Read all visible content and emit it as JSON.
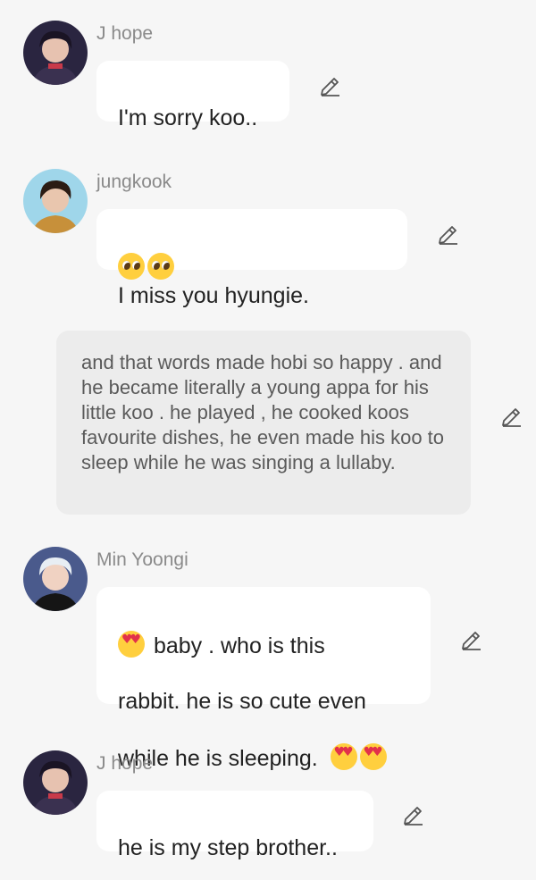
{
  "colors": {
    "background": "#f6f6f6",
    "bubble": "#ffffff",
    "narration_bg": "#ececec",
    "name_text": "#8a8a8a"
  },
  "messages": [
    {
      "author": "J hope",
      "text": "I'm sorry koo..",
      "avatar_icon": "jhope-avatar"
    },
    {
      "author": "jungkook",
      "emoji": "pleading-face-icon x2",
      "text": "I miss you hyungie.",
      "avatar_icon": "jungkook-avatar"
    },
    {
      "author": "Min Yoongi",
      "line1": "baby . who is this",
      "line2": "rabbit.   he is so cute even",
      "line3": "while he is sleeping.",
      "avatar_icon": "yoongi-avatar"
    },
    {
      "author": "J hope",
      "text": "he is my step brother..",
      "avatar_icon": "jhope-avatar"
    }
  ],
  "narration": {
    "text": "and that words made hobi so happy . and he became literally a young appa for his little koo . he played , he cooked koos favourite dishes, he even made his koo to sleep while he was singing a lullaby."
  },
  "edit_icon": "pencil-icon"
}
